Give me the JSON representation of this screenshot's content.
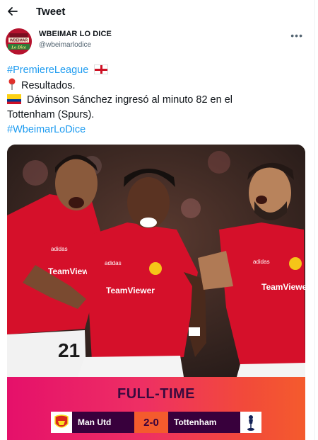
{
  "header": {
    "title": "Tweet",
    "back_icon": "arrow-left-icon"
  },
  "author": {
    "name": "WBEIMAR LO DICE",
    "handle": "@wbeimarlodice",
    "avatar_text": "WBEIMAR",
    "avatar_script": "Lo Dice"
  },
  "tweet": {
    "hashtag1": "#PremiereLeague",
    "line2": "Resultados.",
    "line3a": "Dávinson Sánchez ingresó al minuto 82 en el",
    "line3b": "Tottenham (Spurs).",
    "hashtag2": "#WbeimarLoDice"
  },
  "scoreboard": {
    "status": "FULL-TIME",
    "home": "Man Utd",
    "score": "2-0",
    "away": "Tottenham"
  },
  "photo": {
    "sponsor1": "TeamViewer",
    "sponsor2": "TeamViewer",
    "sponsor3": "TeamViewer",
    "kit_brand": "adidas",
    "shirt_number": "21"
  },
  "colors": {
    "link": "#1d9bf0",
    "kit_red": "#d5102a",
    "pl_purple": "#38003c",
    "pl_pink": "#e5106a"
  }
}
